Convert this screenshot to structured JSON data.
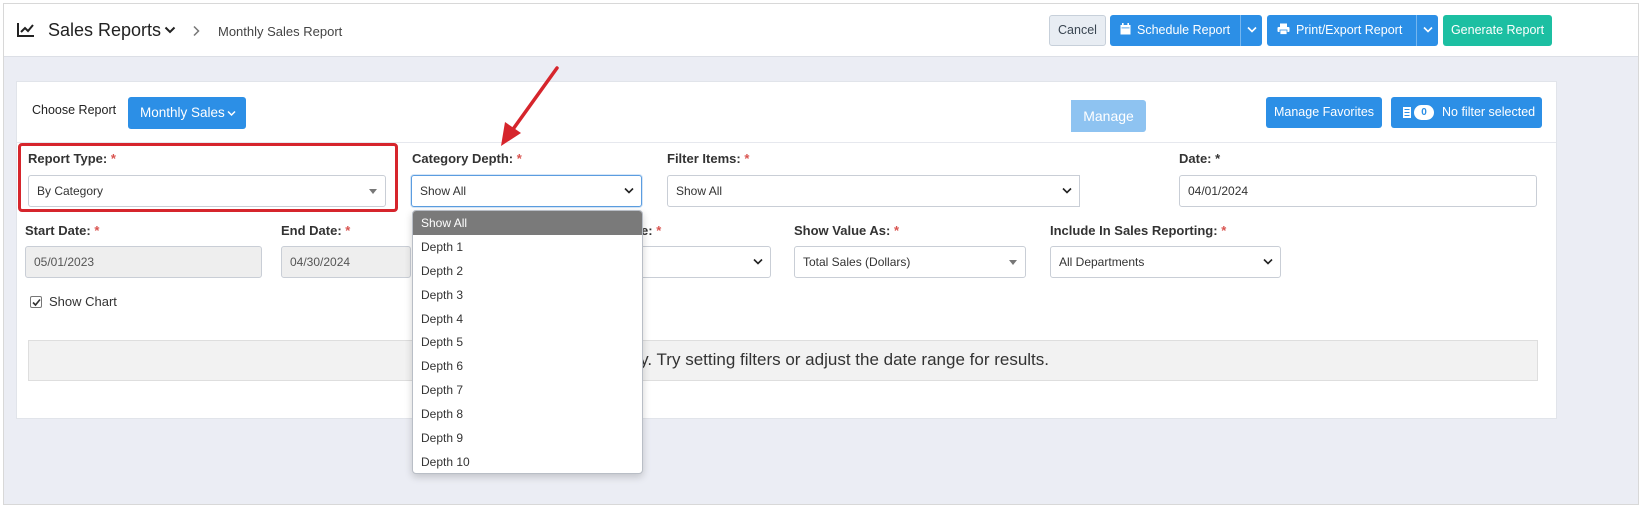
{
  "header": {
    "app_title": "Sales Reports",
    "breadcrumb": "Monthly Sales Report",
    "buttons": {
      "cancel": "Cancel",
      "schedule": "Schedule Report",
      "print_export": "Print/Export Report",
      "generate": "Generate Report"
    }
  },
  "toolbar": {
    "choose_report_label": "Choose Report",
    "report_selected": "Monthly Sales",
    "manage_favorites": "Manage Favorites",
    "filter_count": "0",
    "filter_status": "No filter selected"
  },
  "form": {
    "report_type": {
      "label": "Report Type:",
      "required": "*",
      "value": "By Category"
    },
    "category_depth": {
      "label": "Category Depth:",
      "required": "*",
      "value": "Show All"
    },
    "filter_items": {
      "label": "Filter Items:",
      "required": "*",
      "value": "Show All",
      "manage_label": "Manage"
    },
    "date": {
      "label": "Date:",
      "required": "*",
      "value": "04/01/2024"
    },
    "start_date": {
      "label": "Start Date:",
      "required": "*",
      "value": "05/01/2023"
    },
    "end_date": {
      "label": "End Date:",
      "required": "*",
      "value": "04/30/2024"
    },
    "hidden_field": {
      "label_partial": "e:",
      "required": "*"
    },
    "show_value_as": {
      "label": "Show Value As:",
      "required": "*",
      "value": "Total Sales (Dollars)"
    },
    "include_in_sales": {
      "label": "Include In Sales Reporting:",
      "required": "*",
      "value": "All Departments"
    },
    "show_chart": {
      "label": "Show Chart",
      "checked": true
    }
  },
  "empty_message": "pty. Try setting filters or adjust the date range for results.",
  "category_depth_options": [
    "Show All",
    "Depth 1",
    "Depth 2",
    "Depth 3",
    "Depth 4",
    "Depth 5",
    "Depth 6",
    "Depth 7",
    "Depth 8",
    "Depth 9",
    "Depth 10"
  ],
  "colors": {
    "primary": "#2c8fe6",
    "success": "#1cbfa2",
    "annotation": "#d6252c",
    "required": "#d9534f"
  }
}
